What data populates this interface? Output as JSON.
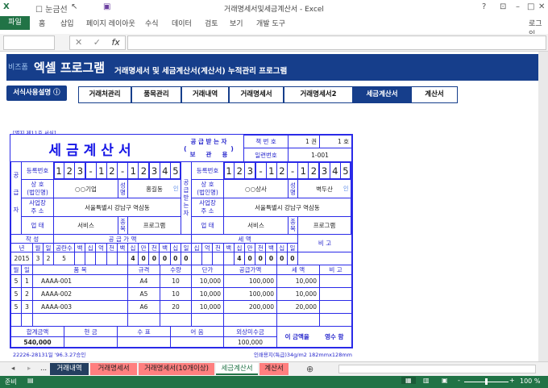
{
  "window": {
    "title": "거래명세서및세금계산서 - Excel",
    "gridlines_label": "눈금선",
    "help": "?",
    "login": "로그인"
  },
  "ribbon": {
    "tabs": [
      "홈",
      "삽입",
      "페이지 레이아웃",
      "수식",
      "데이터",
      "검토",
      "보기",
      "개발 도구"
    ],
    "file": "파일"
  },
  "formula_bar": {
    "fx": "fx",
    "cancel": "✕",
    "enter": "✓"
  },
  "banner": {
    "logo_small": "비즈폼",
    "logo": "엑셀 프로그램",
    "subtitle": "거래명세서 및 세금계산서(계산서) 누적관리 프로그램",
    "bg": "#163e8b"
  },
  "nav": {
    "help": "서식사용설명 ⓘ",
    "items": [
      "거래처관리",
      "품목관리",
      "거래내역",
      "거래명세서",
      "거래명세서2",
      "세금계산서",
      "계산서"
    ],
    "active": 5
  },
  "form": {
    "note": "[별지 제11호 서식]",
    "title": "세금계산서",
    "copy_type": {
      "l1": "공 급 받 는 자",
      "l2": "보     관     용",
      "lp": "(",
      "rp": ")"
    },
    "book_no_label": "책 번 호",
    "book_vol": "1 권",
    "book_no": "1 호",
    "serial_label": "일련번호",
    "serial": "1-001",
    "supplier": {
      "side_label": "공급자",
      "reg_label": "등록번호",
      "reg_digits": [
        "1",
        "2",
        "3",
        "-",
        "1",
        "2",
        "-",
        "1",
        "2",
        "3",
        "4",
        "5"
      ],
      "name_label": "상 호\n(법인명)",
      "name": "○○기업",
      "rep_label": "성명",
      "rep": "홍길동",
      "seal": "인",
      "addr_label": "사업장\n주 소",
      "addr": "서울특별시 강남구 역삼동",
      "type_label": "업 태",
      "type": "서비스",
      "item_label": "종목",
      "item": "프로그램"
    },
    "buyer": {
      "side_label": "공급받는자",
      "reg_label": "등록번호",
      "reg_digits": [
        "1",
        "2",
        "3",
        "-",
        "1",
        "2",
        "-",
        "1",
        "2",
        "3",
        "4",
        "5"
      ],
      "name_label": "상 호\n(법인명)",
      "name": "○○상사",
      "rep_label": "성명",
      "rep": "벽두산",
      "seal": "인",
      "addr_label": "사업장\n주 소",
      "addr": "서울특별시 강남구 역삼동",
      "type_label": "업 태",
      "type": "서비스",
      "item_label": "종목",
      "item": "프로그램"
    },
    "summary": {
      "written_label": "작  성",
      "supply_label": "공  급  가  액",
      "tax_label": "세  액",
      "note_label": "비  고",
      "date_headers": [
        "년",
        "월",
        "일",
        "공란수"
      ],
      "supply_headers": [
        "백",
        "십",
        "억",
        "천",
        "백",
        "십",
        "만",
        "천",
        "백",
        "십",
        "일"
      ],
      "tax_headers": [
        "십",
        "억",
        "천",
        "백",
        "십",
        "만",
        "천",
        "백",
        "십",
        "일"
      ],
      "year": "2015",
      "month": "3",
      "day": "2",
      "blanks": "5",
      "supply_digits": [
        "",
        "",
        "",
        "",
        "",
        "4",
        "0",
        "0",
        "0",
        "0",
        "0"
      ],
      "tax_digits": [
        "",
        "",
        "",
        "",
        "4",
        "0",
        "0",
        "0",
        "0",
        "0"
      ]
    },
    "items": {
      "headers": [
        "월",
        "일",
        "품  목",
        "규격",
        "수량",
        "단가",
        "공급가액",
        "세  액",
        "비  고"
      ],
      "rows": [
        [
          "5",
          "1",
          "AAAA-001",
          "A4",
          "10",
          "10,000",
          "100,000",
          "10,000",
          ""
        ],
        [
          "5",
          "2",
          "AAAA-002",
          "A5",
          "10",
          "10,000",
          "100,000",
          "10,000",
          ""
        ],
        [
          "5",
          "3",
          "AAAA-003",
          "A6",
          "20",
          "10,000",
          "200,000",
          "20,000",
          ""
        ],
        [
          "",
          "",
          "",
          "",
          "",
          "",
          "",
          "",
          ""
        ]
      ]
    },
    "totals": {
      "headers": [
        "합계금액",
        "현  금",
        "수  표",
        "어  음",
        "외상미수금"
      ],
      "values": [
        "540,000",
        "",
        "",
        "",
        "100,000"
      ],
      "receipt_a": "이 금액을",
      "receipt_b": "영수  함"
    },
    "footer_left": "22226-28131일 '96.3.27승인",
    "footer_right": "인쇄용지(특급)34g/m2 182mmx128mm"
  },
  "sheet_tabs": [
    {
      "label": "거래내역",
      "bg": "#243f60",
      "fg": "#ffffff"
    },
    {
      "label": "거래명세서",
      "bg": "#ff7f7f",
      "fg": "#222222"
    },
    {
      "label": "거래명세서(10개이상)",
      "bg": "#ff7f7f",
      "fg": "#222222"
    },
    {
      "label": "세금계산서",
      "bg": "#ffffff",
      "fg": "#217346"
    },
    {
      "label": "계산서",
      "bg": "#ff7f7f",
      "fg": "#222222"
    }
  ],
  "sheet_nav": {
    "ellipsis": "...",
    "add": "⊕"
  },
  "status": {
    "ready": "준비",
    "zoom": "100 %"
  }
}
